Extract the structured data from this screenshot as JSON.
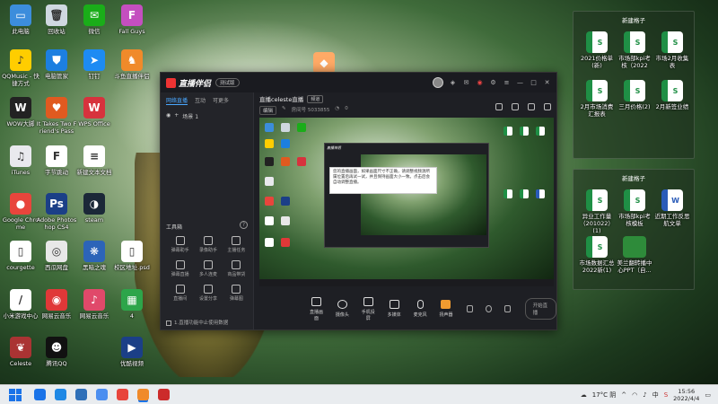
{
  "desktop": {
    "icons_col1": [
      {
        "label": "此电脑",
        "color": "#3c8ddc",
        "glyph": "▭"
      },
      {
        "label": "QQMusic - 快捷方式",
        "color": "#ffcd00",
        "glyph": "♪"
      },
      {
        "label": "WOW大脚",
        "color": "#222222",
        "glyph": "W"
      },
      {
        "label": "iTunes",
        "color": "#e9e9ee",
        "glyph": "♫"
      },
      {
        "label": "Google Chrome",
        "color": "#e8453c",
        "glyph": "●"
      },
      {
        "label": "courgette",
        "color": "#ffffff",
        "glyph": "▯"
      },
      {
        "label": "小米游戏中心",
        "color": "#ffffff",
        "glyph": "/"
      },
      {
        "label": "Celeste",
        "color": "#a33",
        "glyph": "❦"
      }
    ],
    "icons_col2": [
      {
        "label": "回收站",
        "color": "#cfd8e0",
        "glyph": "🗑"
      },
      {
        "label": "电脑管家",
        "color": "#1c7fe0",
        "glyph": "⛊"
      },
      {
        "label": "It Takes Two Friend's Pass",
        "color": "#e05a20",
        "glyph": "♥"
      },
      {
        "label": "字节跳动",
        "color": "#ffffff",
        "glyph": "F"
      },
      {
        "label": "Adobe Photoshop CS4",
        "color": "#1b3f87",
        "glyph": "Ps"
      },
      {
        "label": "西瓜网盘",
        "color": "#e8e8e8",
        "glyph": "◎"
      },
      {
        "label": "网易云音乐",
        "color": "#e03838",
        "glyph": "◉"
      },
      {
        "label": "腾讯QQ",
        "color": "#111111",
        "glyph": "☻"
      }
    ],
    "icons_col3": [
      {
        "label": "微信",
        "color": "#1aad19",
        "glyph": "✉"
      },
      {
        "label": "钉钉",
        "color": "#1d8bf3",
        "glyph": "➤"
      },
      {
        "label": "WPS Office",
        "color": "#d7323d",
        "glyph": "W"
      },
      {
        "label": "新建文本文档",
        "color": "#ffffff",
        "glyph": "≡"
      },
      {
        "label": "steam",
        "color": "#1b2838",
        "glyph": "◑"
      },
      {
        "label": "黑暗之魂",
        "color": "#2c64b8",
        "glyph": "❋"
      },
      {
        "label": "网易云音乐",
        "color": "#e0496a",
        "glyph": "♪"
      }
    ],
    "icons_col4": [
      {
        "label": "Fall Guys",
        "color": "#c44fbf",
        "glyph": "F"
      },
      {
        "label": "斗鱼直播伴侣",
        "color": "#f08a2a",
        "glyph": "♞"
      },
      {
        "label": "校区地址.psd",
        "color": "#ffffff",
        "glyph": "▯"
      },
      {
        "label": "4",
        "color": "#2da54a",
        "glyph": "▦"
      },
      {
        "label": "优酷视频",
        "color": "#1b3f87",
        "glyph": "▶"
      }
    ],
    "icons_col5": [
      {
        "label": "新建文本文档(2)",
        "color": "#ffaa66",
        "glyph": "◆"
      }
    ]
  },
  "fence_top": {
    "title": "新建格子",
    "items": [
      {
        "label": "2021价格单(新)"
      },
      {
        "label": "市场部kpi考核（2022"
      },
      {
        "label": "市场2月收集表"
      },
      {
        "label": "2月市场消费汇报表"
      },
      {
        "label": "三月价格(2)"
      },
      {
        "label": "2月新签业绩"
      }
    ]
  },
  "fence_bottom": {
    "title": "新建格子",
    "items": [
      {
        "label": "异业工作量（201022）(1)",
        "kind": "xls"
      },
      {
        "label": "市场部kpi考核模板",
        "kind": "xls"
      },
      {
        "label": "近期工作反思航文单",
        "kind": "doc"
      },
      {
        "label": "市场数据汇总2022新(1)",
        "kind": "xls"
      },
      {
        "label": "美兰翻转播中心PPT（自...",
        "kind": "img"
      }
    ]
  },
  "app": {
    "name": "直播伴侣",
    "version_badge": "测试版",
    "tabs": [
      "网络直播",
      "互动",
      "可更多"
    ],
    "scene_label": "场景 1",
    "room_title": "直播celeste直播",
    "room_tag": "频道",
    "sub_tag": "编辑",
    "sub_id": "房间号 5033855",
    "sub_count": "0",
    "tools_title": "工具箱",
    "tools": [
      "弹幕助手",
      "录像助手",
      "主播任务",
      "弹幕直播",
      "多人连麦",
      "商品带货",
      "直播间",
      "设置分享",
      "弹幕图"
    ],
    "footer": "1.直播功能中止使用数据",
    "popup_text": "您的直播画面，如果画面尺寸不正确，请调整视频源所属位置后再试一试，并且保持画面大小一致。点击后会自动调整直播。",
    "bottom_items": [
      "直播画面",
      "摄像头",
      "手机投屏",
      "多媒体",
      "麦克风",
      "扬声器"
    ],
    "start_label": "开始直播"
  },
  "taskbar": {
    "weather": "17°C 阴",
    "ime": "中",
    "time": "15:56",
    "date": "2022/4/4",
    "apps": [
      {
        "color": "#1a73e8"
      },
      {
        "color": "#1e88e5"
      },
      {
        "color": "#2e6fb8"
      },
      {
        "color": "#4b8ef0"
      },
      {
        "color": "#e8453c"
      },
      {
        "color": "#f08a2a",
        "active": true
      },
      {
        "color": "#cc2b2b"
      }
    ]
  }
}
